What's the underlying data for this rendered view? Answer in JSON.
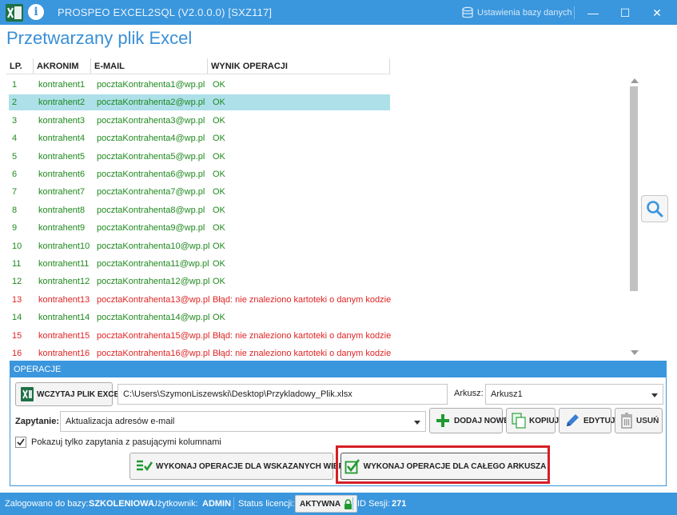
{
  "window": {
    "title": "PROSPEO EXCEL2SQL (V2.0.0.0) [SXZ117]",
    "db_settings_label": "Ustawienia bazy danych",
    "minimize": "—",
    "maximize": "☐",
    "close": "✕",
    "excel_icon": "excel-icon",
    "info_icon": "info-icon",
    "info_glyph": "i"
  },
  "heading": "Przetwarzany plik Excel",
  "grid": {
    "columns": [
      "LP.",
      "AKRONIM",
      "E-MAIL",
      "WYNIK OPERACJI"
    ],
    "selected_row": 2,
    "rows": [
      {
        "lp": "1",
        "akronim": "kontrahent1",
        "email": "pocztaKontrahenta1@wp.pl",
        "wynik": "OK",
        "status": "ok"
      },
      {
        "lp": "2",
        "akronim": "kontrahent2",
        "email": "pocztaKontrahenta2@wp.pl",
        "wynik": "OK",
        "status": "ok"
      },
      {
        "lp": "3",
        "akronim": "kontrahent3",
        "email": "pocztaKontrahenta3@wp.pl",
        "wynik": "OK",
        "status": "ok"
      },
      {
        "lp": "4",
        "akronim": "kontrahent4",
        "email": "pocztaKontrahenta4@wp.pl",
        "wynik": "OK",
        "status": "ok"
      },
      {
        "lp": "5",
        "akronim": "kontrahent5",
        "email": "pocztaKontrahenta5@wp.pl",
        "wynik": "OK",
        "status": "ok"
      },
      {
        "lp": "6",
        "akronim": "kontrahent6",
        "email": "pocztaKontrahenta6@wp.pl",
        "wynik": "OK",
        "status": "ok"
      },
      {
        "lp": "7",
        "akronim": "kontrahent7",
        "email": "pocztaKontrahenta7@wp.pl",
        "wynik": "OK",
        "status": "ok"
      },
      {
        "lp": "8",
        "akronim": "kontrahent8",
        "email": "pocztaKontrahenta8@wp.pl",
        "wynik": "OK",
        "status": "ok"
      },
      {
        "lp": "9",
        "akronim": "kontrahent9",
        "email": "pocztaKontrahenta9@wp.pl",
        "wynik": "OK",
        "status": "ok"
      },
      {
        "lp": "10",
        "akronim": "kontrahent10",
        "email": "pocztaKontrahenta10@wp.pl",
        "wynik": "OK",
        "status": "ok"
      },
      {
        "lp": "11",
        "akronim": "kontrahent11",
        "email": "pocztaKontrahenta11@wp.pl",
        "wynik": "OK",
        "status": "ok"
      },
      {
        "lp": "12",
        "akronim": "kontrahent12",
        "email": "pocztaKontrahenta12@wp.pl",
        "wynik": "OK",
        "status": "ok"
      },
      {
        "lp": "13",
        "akronim": "kontrahent13",
        "email": "pocztaKontrahenta13@wp.pl",
        "wynik": "Błąd: nie znaleziono kartoteki o danym kodzie",
        "status": "error"
      },
      {
        "lp": "14",
        "akronim": "kontrahent14",
        "email": "pocztaKontrahenta14@wp.pl",
        "wynik": "OK",
        "status": "ok"
      },
      {
        "lp": "15",
        "akronim": "kontrahent15",
        "email": "pocztaKontrahenta15@wp.pl",
        "wynik": "Błąd: nie znaleziono kartoteki o danym kodzie",
        "status": "error"
      },
      {
        "lp": "16",
        "akronim": "kontrahent16",
        "email": "pocztaKontrahenta16@wp.pl",
        "wynik": "Błąd: nie znaleziono kartoteki o danym kodzie",
        "status": "error"
      }
    ]
  },
  "operations": {
    "header": "OPERACJE",
    "load_button": "WCZYTAJ PLIK EXCEL",
    "file_path": "C:\\Users\\SzymonLiszewski\\Desktop\\Przykladowy_Plik.xlsx",
    "sheet_label": "Arkusz:",
    "sheet_value": "Arkusz1",
    "query_label": "Zapytanie:",
    "query_value": "Aktualizacja adresów e-mail",
    "add_button": "DODAJ NOWE",
    "copy_button": "KOPIUJ",
    "edit_button": "EDYTUJ",
    "delete_button": "USUŃ",
    "filter_checkbox_label": "Pokazuj tylko zapytania z pasującymi kolumnami",
    "filter_checked": true,
    "run_selected_button": "WYKONAJ OPERACJE DLA WSKAZANYCH WIERSZY",
    "run_all_button": "WYKONAJ OPERACJE DLA CAŁEGO ARKUSZA"
  },
  "statusbar": {
    "db_label": "Zalogowano do bazy:",
    "db_value": "SZKOLENIOWA",
    "user_label": "Użytkownik:",
    "user_value": "ADMIN",
    "license_label": "Status licencji:",
    "license_value": "AKTYWNA",
    "session_label": "ID Sesji:",
    "session_value": "271"
  },
  "colors": {
    "accent": "#3a96dd",
    "ok": "#1f8a1f",
    "error": "#e02424",
    "selection": "#aee0ea",
    "highlight": "#d51f26"
  }
}
